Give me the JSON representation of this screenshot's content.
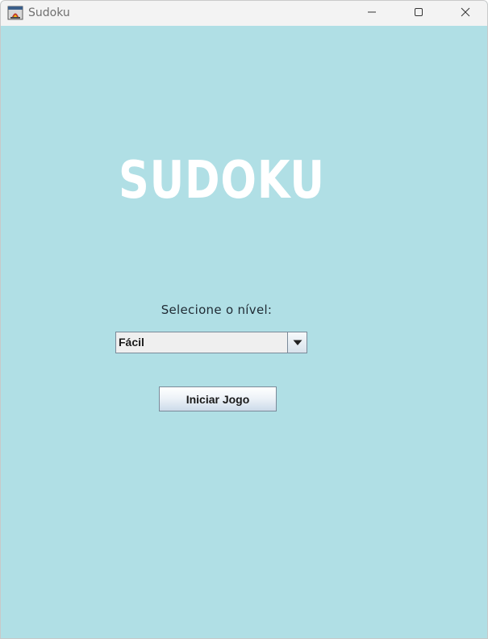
{
  "window": {
    "title": "Sudoku",
    "controls": {
      "minimize": "minimize-icon",
      "maximize": "maximize-icon",
      "close": "close-icon"
    }
  },
  "main": {
    "title": "SUDOKU",
    "level_label": "Selecione o nível:",
    "level_select": {
      "selected": "Fácil",
      "icon": "chevron-down-icon"
    },
    "start_button_label": "Iniciar Jogo"
  },
  "colors": {
    "background": "#b0dfe5",
    "title_text": "#ffffff",
    "titlebar": "#f3f3f3"
  }
}
